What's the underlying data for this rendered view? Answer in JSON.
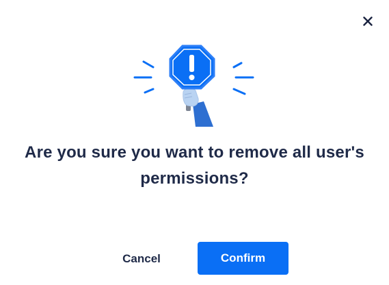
{
  "dialog": {
    "close_icon": "close-icon",
    "illustration_icon": "warning-sign-illustration",
    "message_line1": "Are you sure you want to remove all user's",
    "message_line2": "permissions?",
    "cancel_label": "Cancel",
    "confirm_label": "Confirm"
  },
  "colors": {
    "accent": "#0a6ff5",
    "text_dark": "#1f2a48",
    "background": "#ffffff"
  }
}
